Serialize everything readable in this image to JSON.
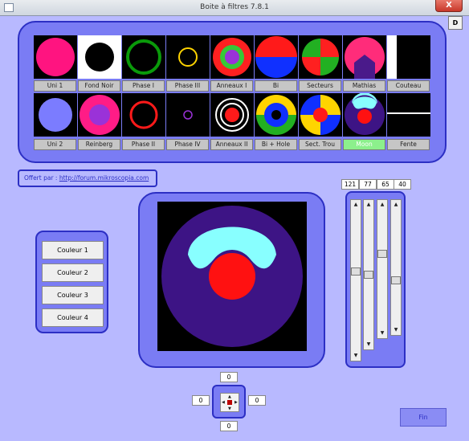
{
  "window": {
    "title": "Boite à filtres 7.8.1",
    "close_glyph": "X",
    "d_button": "D"
  },
  "filters": {
    "row1": [
      {
        "label": "Uni 1"
      },
      {
        "label": "Fond Noir"
      },
      {
        "label": "Phase I"
      },
      {
        "label": "Phase III"
      },
      {
        "label": "Anneaux I"
      },
      {
        "label": "Bi"
      },
      {
        "label": "Secteurs"
      },
      {
        "label": "Mathias"
      },
      {
        "label": "Couteau"
      }
    ],
    "row2": [
      {
        "label": "Uni 2"
      },
      {
        "label": "Reinberg"
      },
      {
        "label": "Phase II"
      },
      {
        "label": "Phase IV"
      },
      {
        "label": "Anneaux II"
      },
      {
        "label": "Bi + Hole"
      },
      {
        "label": "Sect. Trou"
      },
      {
        "label": "Moon",
        "selected": true
      },
      {
        "label": "Fente"
      }
    ]
  },
  "offer": {
    "prefix": "Offert par :",
    "link": "http://forum.mikroscopia.com"
  },
  "colors": {
    "buttons": [
      "Couleur 1",
      "Couleur 2",
      "Couleur 3",
      "Couleur 4"
    ]
  },
  "sliders": {
    "values": [
      "121",
      "77",
      "65",
      "40"
    ]
  },
  "position": {
    "top": "0",
    "left": "0",
    "right": "0",
    "bottom": "0"
  },
  "fin_label": "Fin",
  "colors_palette": {
    "background": "#b8b9ff",
    "panel": "#7a7cf4",
    "panel_border": "#2c2fc4",
    "preview_bg": "#3d1485",
    "moon": "#88ffff",
    "center": "#ff1111"
  }
}
